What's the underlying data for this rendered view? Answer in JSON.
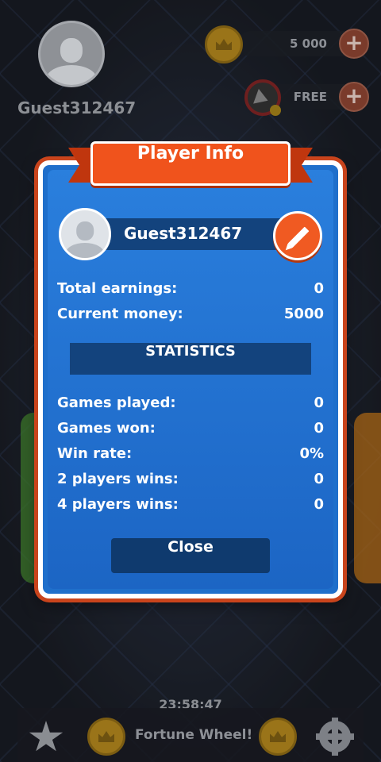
{
  "top_bar": {
    "username": "Guest312467",
    "coins": "5 000",
    "free_label": "FREE",
    "plus_symbol": "+"
  },
  "modal": {
    "title": "Player Info",
    "player_name": "Guest312467",
    "total_earnings_label": "Total earnings:",
    "total_earnings_value": "0",
    "current_money_label": "Current money:",
    "current_money_value": "5000",
    "statistics_header": "STATISTICS",
    "stats": [
      {
        "label": "Games played:",
        "value": "0"
      },
      {
        "label": "Games won:",
        "value": "0"
      },
      {
        "label": "Win rate:",
        "value": "0%"
      },
      {
        "label": "2 players wins:",
        "value": "0"
      },
      {
        "label": "4 players wins:",
        "value": "0"
      }
    ],
    "close_label": "Close"
  },
  "bottom_bar": {
    "timer": "23:58:47",
    "fortune_label": "Fortune Wheel!"
  },
  "colors": {
    "modal_blue": "#1f6fcb",
    "ribbon_orange": "#f0531c",
    "dark_bar": "#13437d",
    "close_button": "#0f3a6e"
  },
  "icons": {
    "avatar": "avatar-icon",
    "coin": "crown-coin-icon",
    "video": "video-ad-icon",
    "edit": "pencil-icon",
    "star": "star-icon",
    "settings": "gear-icon"
  }
}
